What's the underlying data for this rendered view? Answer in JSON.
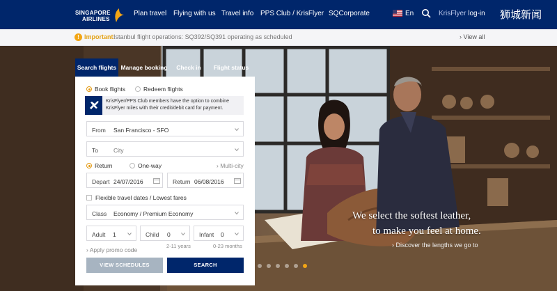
{
  "brand": {
    "line1": "SINGAPORE",
    "line2": "AIRLINES"
  },
  "nav": {
    "items": [
      "Plan travel",
      "Flying with us",
      "Travel info",
      "PPS Club / KrisFlyer",
      "SQCorporate"
    ],
    "language": "En",
    "login_prefix": "KrisFlyer",
    "login_action": "log-in",
    "watermark": "狮城新闻"
  },
  "alert": {
    "label": "Important:",
    "text": "Istanbul flight operations: SQ392/SQ391 operating as scheduled",
    "view_all": "View all"
  },
  "booking": {
    "tabs": [
      "Search flights",
      "Manage booking",
      "Check in",
      "Flight status"
    ],
    "modes": {
      "book": "Book flights",
      "redeem": "Redeem flights"
    },
    "info": "KrisFlyer/PPS Club members have the option to combine KrisFlyer miles with their credit/debit card for payment.",
    "from": {
      "label": "From",
      "value": "San Francisco - SFO"
    },
    "to": {
      "label": "To",
      "placeholder": "City"
    },
    "trip": {
      "return": "Return",
      "oneway": "One-way",
      "multicity": "Multi-city"
    },
    "depart": {
      "label": "Depart",
      "value": "24/07/2016"
    },
    "return_date": {
      "label": "Return",
      "value": "06/08/2016"
    },
    "flexible": "Flexible travel dates / Lowest fares",
    "class": {
      "label": "Class",
      "value": "Economy / Premium Economy"
    },
    "adult": {
      "label": "Adult",
      "value": "1"
    },
    "child": {
      "label": "Child",
      "value": "0",
      "note": "2-11 years"
    },
    "infant": {
      "label": "Infant",
      "value": "0",
      "note": "0-23 months"
    },
    "promo": "Apply promo code",
    "btn_view": "VIEW SCHEDULES",
    "btn_search": "SEARCH"
  },
  "hero": {
    "line1": "We select the softest leather,",
    "line2": "to make you feel at home.",
    "link": "Discover the lengths we go to"
  },
  "colors": {
    "navy": "#00266b",
    "accent": "#f2a515"
  }
}
